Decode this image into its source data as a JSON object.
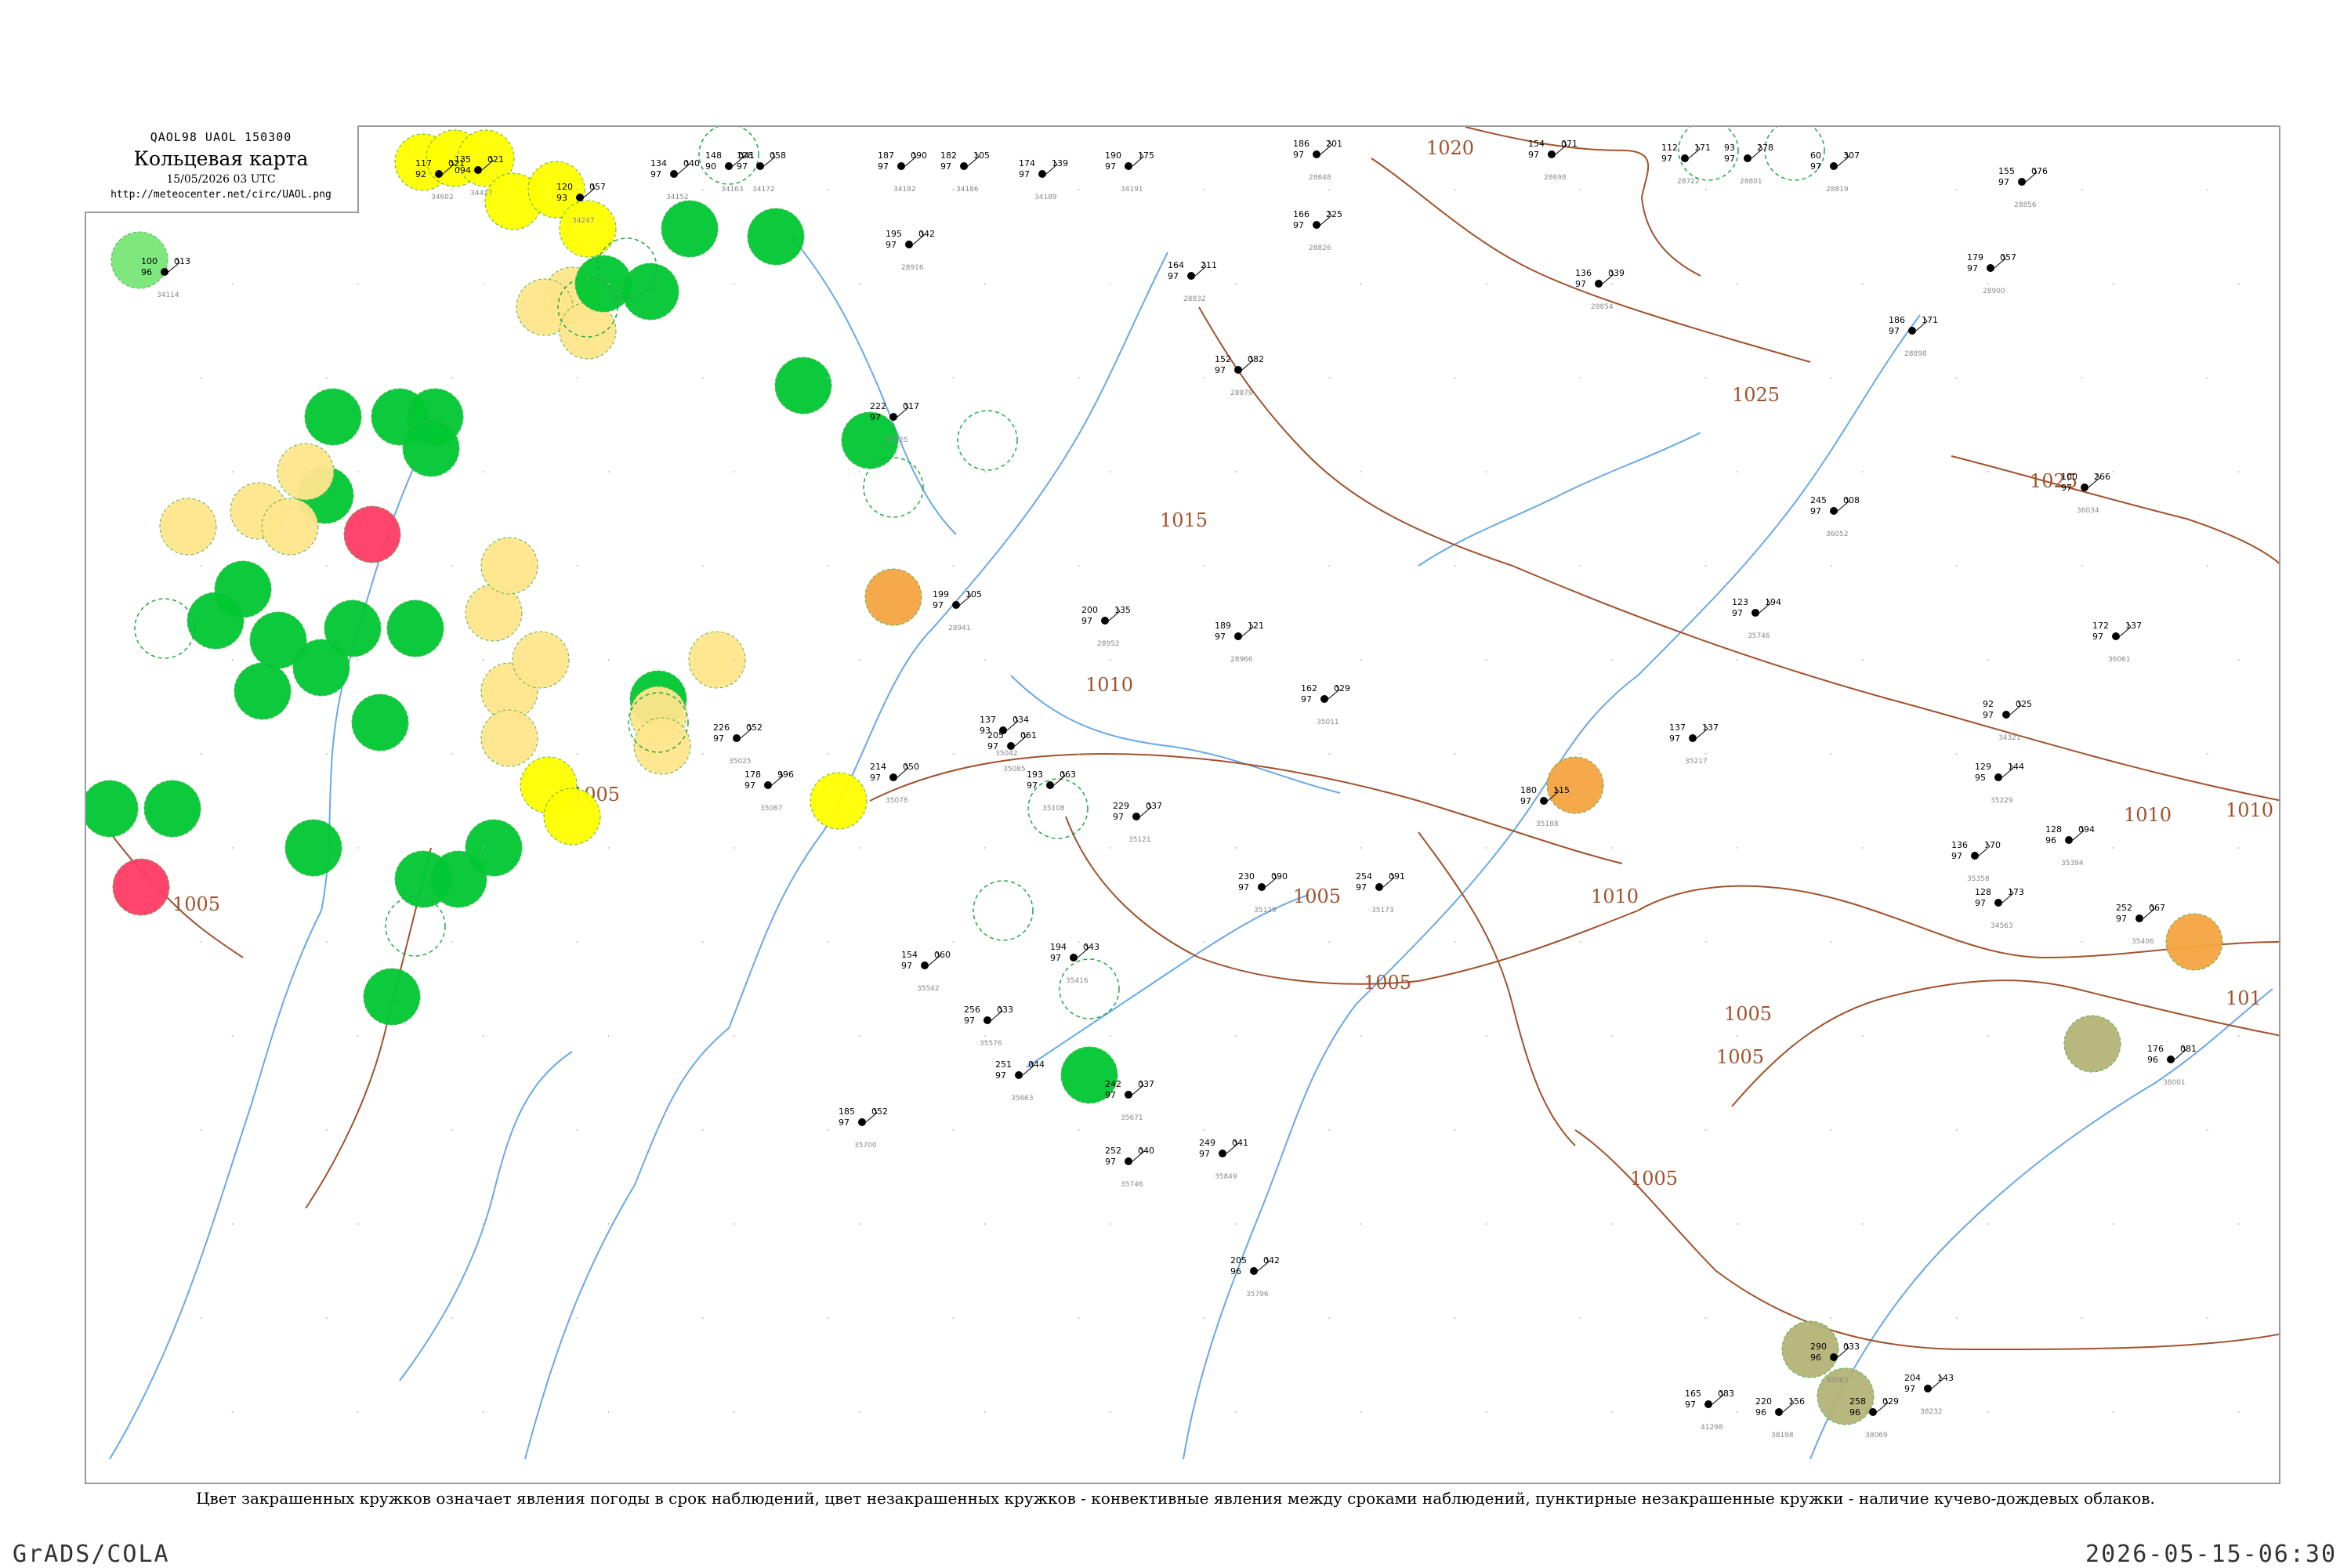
{
  "header": {
    "codes": "QAOL98  UAOL  150300",
    "title": "Кольцевая карта",
    "date": "15/05/2026 03 UTC",
    "url": "http://meteocenter.net/circ/UAOL.png"
  },
  "caption": "Цвет закрашенных кружков означает явления погоды в срок наблюдений, цвет незакрашенных кружков - конвективные явления между сроками наблюдений, пунктирные незакрашенные кружки - наличие кучево-дождевых облаков.",
  "footer": {
    "left": "GrADS/COLA",
    "right": "2026-05-15-06:30"
  },
  "colors": {
    "isobar": "#a0522d",
    "river": "#6aa8e8",
    "rain": "#00c832",
    "thunder": "#ff3c64",
    "fog": "#ffff00",
    "haze": "#ffe68c",
    "dust": "#f5a541",
    "smoke": "#b4b478",
    "drizzle": "#78e678"
  },
  "isobar_labels": [
    "1020",
    "1025",
    "1015",
    "1010",
    "1005",
    "1005",
    "1010",
    "1025",
    "1005",
    "1005",
    "1005",
    "1010",
    "1010",
    "1005",
    "1005",
    "101"
  ],
  "station_plots": [
    {
      "p": "100",
      "t": "96",
      "d": "013",
      "id": "34114"
    },
    {
      "p": "117",
      "t": "92",
      "d": "021",
      "id": "34602"
    },
    {
      "p": "135",
      "t": "094",
      "d": "021",
      "id": "34417"
    },
    {
      "p": "120",
      "t": "93",
      "d": "057",
      "id": "34247"
    },
    {
      "p": "134",
      "t": "97",
      "d": "040",
      "id": "34152"
    },
    {
      "p": "148",
      "t": "90",
      "d": "041",
      "id": "34163"
    },
    {
      "p": "128",
      "t": "97",
      "d": "058",
      "id": "34172"
    },
    {
      "p": "187",
      "t": "97",
      "d": "090",
      "id": "34182"
    },
    {
      "p": "182",
      "t": "97",
      "d": "105",
      "id": "34186"
    },
    {
      "p": "174",
      "t": "97",
      "d": "139",
      "id": "34189"
    },
    {
      "p": "190",
      "t": "97",
      "d": "175",
      "id": "34191"
    },
    {
      "p": "186",
      "t": "97",
      "d": "201",
      "id": "28648"
    },
    {
      "p": "154",
      "t": "97",
      "d": "071",
      "id": "28698"
    },
    {
      "p": "112",
      "t": "97",
      "d": "171",
      "id": "28722"
    },
    {
      "p": "93",
      "t": "97",
      "d": "278",
      "id": "28801"
    },
    {
      "p": "60",
      "t": "97",
      "d": "307",
      "id": "28819"
    },
    {
      "p": "166",
      "t": "97",
      "d": "225",
      "id": "28826"
    },
    {
      "p": "164",
      "t": "97",
      "d": "211",
      "id": "28832"
    },
    {
      "p": "136",
      "t": "97",
      "d": "039",
      "id": "28854"
    },
    {
      "p": "155",
      "t": "97",
      "d": "076",
      "id": "28856"
    },
    {
      "p": "152",
      "t": "97",
      "d": "082",
      "id": "28879"
    },
    {
      "p": "186",
      "t": "97",
      "d": "171",
      "id": "28898"
    },
    {
      "p": "179",
      "t": "97",
      "d": "057",
      "id": "28900"
    },
    {
      "p": "195",
      "t": "97",
      "d": "042",
      "id": "28916"
    },
    {
      "p": "222",
      "t": "97",
      "d": "017",
      "id": "28925"
    },
    {
      "p": "199",
      "t": "97",
      "d": "105",
      "id": "28941"
    },
    {
      "p": "200",
      "t": "97",
      "d": "135",
      "id": "28952"
    },
    {
      "p": "189",
      "t": "97",
      "d": "121",
      "id": "28966"
    },
    {
      "p": "162",
      "t": "97",
      "d": "029",
      "id": "35011"
    },
    {
      "p": "226",
      "t": "97",
      "d": "052",
      "id": "35025"
    },
    {
      "p": "137",
      "t": "93",
      "d": "034",
      "id": "35042"
    },
    {
      "p": "178",
      "t": "97",
      "d": "996",
      "id": "35067"
    },
    {
      "p": "214",
      "t": "97",
      "d": "050",
      "id": "35078"
    },
    {
      "p": "205",
      "t": "97",
      "d": "061",
      "id": "35085"
    },
    {
      "p": "193",
      "t": "97",
      "d": "063",
      "id": "35108"
    },
    {
      "p": "229",
      "t": "97",
      "d": "037",
      "id": "35121"
    },
    {
      "p": "230",
      "t": "97",
      "d": "090",
      "id": "35129"
    },
    {
      "p": "254",
      "t": "97",
      "d": "091",
      "id": "35173"
    },
    {
      "p": "180",
      "t": "97",
      "d": "115",
      "id": "35188"
    },
    {
      "p": "137",
      "t": "97",
      "d": "137",
      "id": "35217"
    },
    {
      "p": "129",
      "t": "95",
      "d": "144",
      "id": "35229"
    },
    {
      "p": "136",
      "t": "97",
      "d": "170",
      "id": "35358"
    },
    {
      "p": "128",
      "t": "96",
      "d": "094",
      "id": "35394"
    },
    {
      "p": "252",
      "t": "97",
      "d": "067",
      "id": "35406"
    },
    {
      "p": "194",
      "t": "97",
      "d": "043",
      "id": "35416"
    },
    {
      "p": "154",
      "t": "97",
      "d": "060",
      "id": "35542"
    },
    {
      "p": "256",
      "t": "97",
      "d": "033",
      "id": "35576"
    },
    {
      "p": "251",
      "t": "97",
      "d": "044",
      "id": "35663"
    },
    {
      "p": "242",
      "t": "97",
      "d": "037",
      "id": "35671"
    },
    {
      "p": "185",
      "t": "97",
      "d": "052",
      "id": "35700"
    },
    {
      "p": "252",
      "t": "97",
      "d": "040",
      "id": "35746"
    },
    {
      "p": "249",
      "t": "97",
      "d": "041",
      "id": "35849"
    },
    {
      "p": "205",
      "t": "96",
      "d": "042",
      "id": "35796"
    },
    {
      "p": "176",
      "t": "96",
      "d": "081",
      "id": "38001"
    },
    {
      "p": "290",
      "t": "96",
      "d": "033",
      "id": "38062"
    },
    {
      "p": "258",
      "t": "96",
      "d": "029",
      "id": "38069"
    },
    {
      "p": "220",
      "t": "96",
      "d": "156",
      "id": "38198"
    },
    {
      "p": "165",
      "t": "97",
      "d": "083",
      "id": "41298"
    },
    {
      "p": "204",
      "t": "97",
      "d": "143",
      "id": "38232"
    },
    {
      "p": "128",
      "t": "97",
      "d": "173",
      "id": "34563"
    },
    {
      "p": "123",
      "t": "97",
      "d": "194",
      "id": "35746"
    },
    {
      "p": "100",
      "t": "97",
      "d": "266",
      "id": "36034"
    },
    {
      "p": "245",
      "t": "97",
      "d": "008",
      "id": "36052"
    },
    {
      "p": "172",
      "t": "97",
      "d": "137",
      "id": "36061"
    },
    {
      "p": "92",
      "t": "97",
      "d": "025",
      "id": "34321"
    }
  ]
}
